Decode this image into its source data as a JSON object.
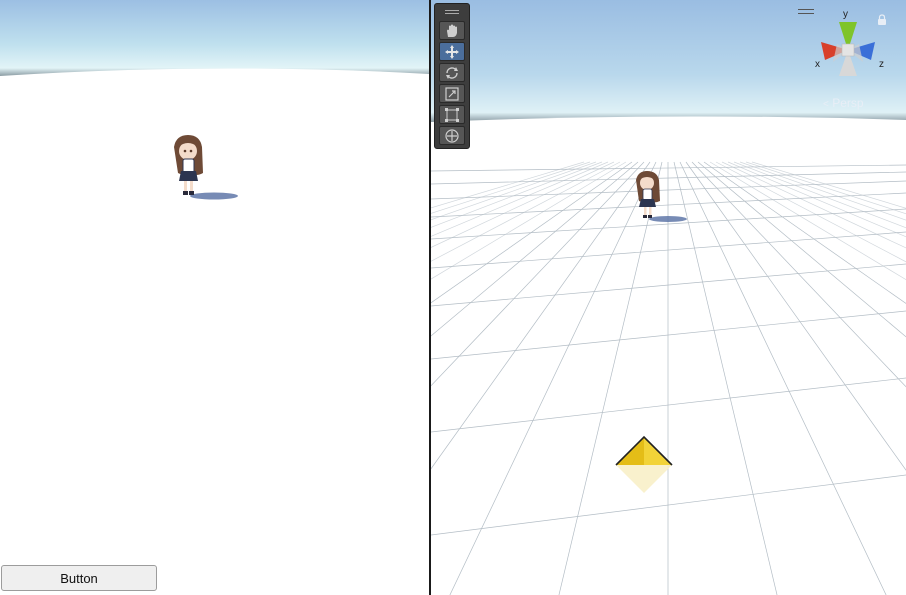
{
  "game_view": {
    "button_label": "Button"
  },
  "scene_view": {
    "projection_label": "Persp",
    "gizmo_axes": {
      "x": "x",
      "y": "y",
      "z": "z"
    },
    "tools": [
      {
        "name": "hand-tool",
        "icon": "hand-icon",
        "active": false
      },
      {
        "name": "move-tool",
        "icon": "move-icon",
        "active": true
      },
      {
        "name": "rotate-tool",
        "icon": "rotate-icon",
        "active": false
      },
      {
        "name": "scale-tool",
        "icon": "scale-icon",
        "active": false
      },
      {
        "name": "rect-tool",
        "icon": "rect-transform-icon",
        "active": false
      },
      {
        "name": "transform-tool",
        "icon": "transform-icon",
        "active": false
      }
    ]
  },
  "colors": {
    "sky_top": "#9dbfe4",
    "horizon": "#dff2f6",
    "ground": "#ffffff",
    "grid_line": "#9aa7b2",
    "tool_active": "#4b6e9c",
    "gizmo_x": "#d8402b",
    "gizmo_y": "#7fc42a",
    "gizmo_z": "#3a6fd8",
    "light_gizmo": "#e8c41a"
  }
}
